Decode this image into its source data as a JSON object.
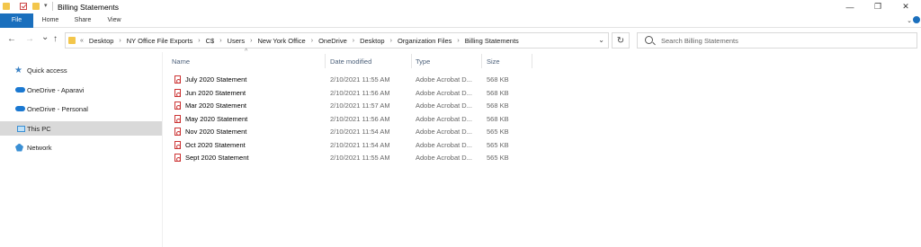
{
  "window": {
    "title": "Billing Statements",
    "controls": [
      "minimize",
      "maximize",
      "close"
    ]
  },
  "ribbon": {
    "tabs": [
      "File",
      "Home",
      "Share",
      "View"
    ],
    "quick_access_sep": "▾"
  },
  "navigation": {
    "back": "←",
    "forward": "→",
    "recent": "⌄",
    "up": "↑",
    "refresh": "↻"
  },
  "address_bar": {
    "overflow": "«",
    "crumbs": [
      "Desktop",
      "NY Office File Exports",
      "C$",
      "Users",
      "New York Office",
      "OneDrive",
      "Desktop",
      "Organization Files",
      "Billing Statements"
    ],
    "separator": "›",
    "dropdown": "⌄"
  },
  "search": {
    "placeholder": "Search Billing Statements"
  },
  "sidebar": {
    "items": [
      {
        "label": "Quick access",
        "icon": "star-icon"
      },
      {
        "label": "OneDrive - Aparavi",
        "icon": "cloud-icon"
      },
      {
        "label": "OneDrive - Personal",
        "icon": "cloud-icon"
      },
      {
        "label": "This PC",
        "icon": "computer-icon",
        "selected": true
      },
      {
        "label": "Network",
        "icon": "network-icon"
      }
    ]
  },
  "file_list": {
    "columns": [
      "Name",
      "Date modified",
      "Type",
      "Size"
    ],
    "sort_indicator": "^",
    "rows": [
      {
        "name": "July 2020 Statement",
        "date": "2/10/2021 11:55 AM",
        "type": "Adobe Acrobat D...",
        "size": "568 KB"
      },
      {
        "name": "Jun 2020 Statement",
        "date": "2/10/2021 11:56 AM",
        "type": "Adobe Acrobat D...",
        "size": "568 KB"
      },
      {
        "name": "Mar 2020 Statement",
        "date": "2/10/2021 11:57 AM",
        "type": "Adobe Acrobat D...",
        "size": "568 KB"
      },
      {
        "name": "May 2020 Statement",
        "date": "2/10/2021 11:56 AM",
        "type": "Adobe Acrobat D...",
        "size": "568 KB"
      },
      {
        "name": "Nov 2020 Statement",
        "date": "2/10/2021 11:54 AM",
        "type": "Adobe Acrobat D...",
        "size": "565 KB"
      },
      {
        "name": "Oct 2020 Statement",
        "date": "2/10/2021 11:54 AM",
        "type": "Adobe Acrobat D...",
        "size": "565 KB"
      },
      {
        "name": "Sept 2020 Statement",
        "date": "2/10/2021 11:55 AM",
        "type": "Adobe Acrobat D...",
        "size": "565 KB"
      }
    ]
  },
  "colors": {
    "accent": "#1a6fbd",
    "folder": "#f3c64b",
    "selected_bg": "#d9d9d9",
    "header_text": "#4c607a"
  }
}
